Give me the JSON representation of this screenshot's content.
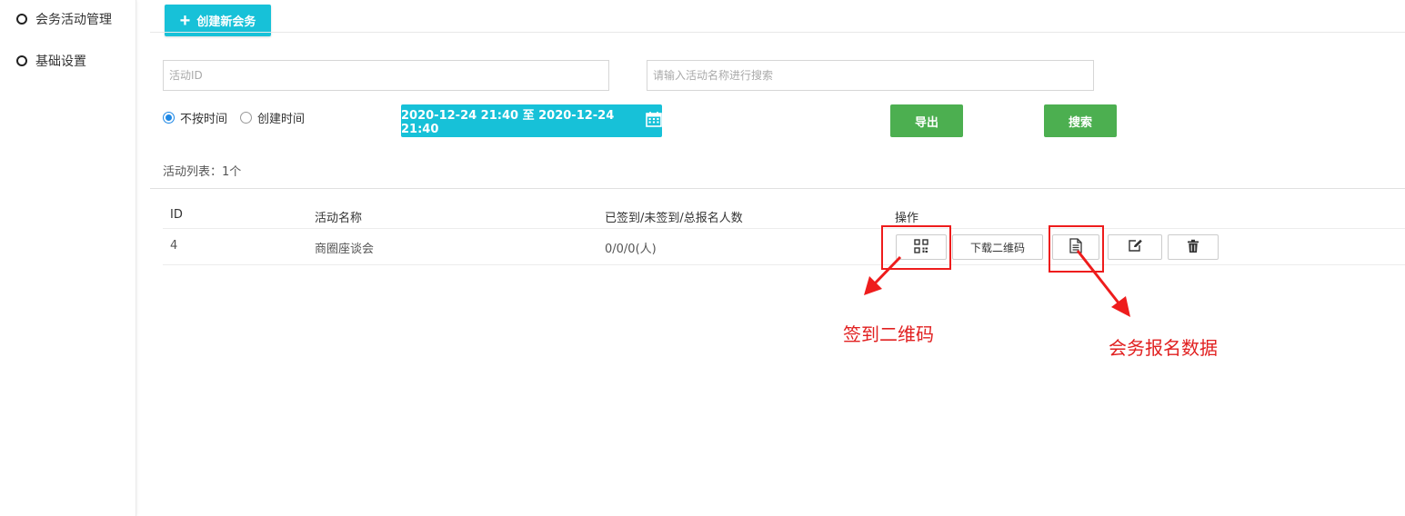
{
  "sidebar": {
    "items": [
      {
        "label": "会务活动管理"
      },
      {
        "label": "基础设置"
      }
    ]
  },
  "toolbar": {
    "create_label": "创建新会务"
  },
  "filters": {
    "id_placeholder": "活动ID",
    "name_placeholder": "请输入活动名称进行搜索",
    "radio_options": [
      {
        "label": "不按时间",
        "selected": true
      },
      {
        "label": "创建时间",
        "selected": false
      }
    ],
    "date_range": "2020-12-24 21:40 至 2020-12-24 21:40",
    "export_label": "导出",
    "search_label": "搜索"
  },
  "list": {
    "count_label": "活动列表：1个"
  },
  "table": {
    "headers": [
      "ID",
      "活动名称",
      "已签到/未签到/总报名人数",
      "操作"
    ],
    "rows": [
      {
        "id": "4",
        "name": "商圈座谈会",
        "stats": "0/0/0(人)",
        "download_label": "下载二维码"
      }
    ]
  },
  "annotations": {
    "qr_label": "签到二维码",
    "data_label": "会务报名数据",
    "color": "#e12020"
  },
  "colors": {
    "accent": "#17c1d8",
    "green": "#4caf50"
  }
}
